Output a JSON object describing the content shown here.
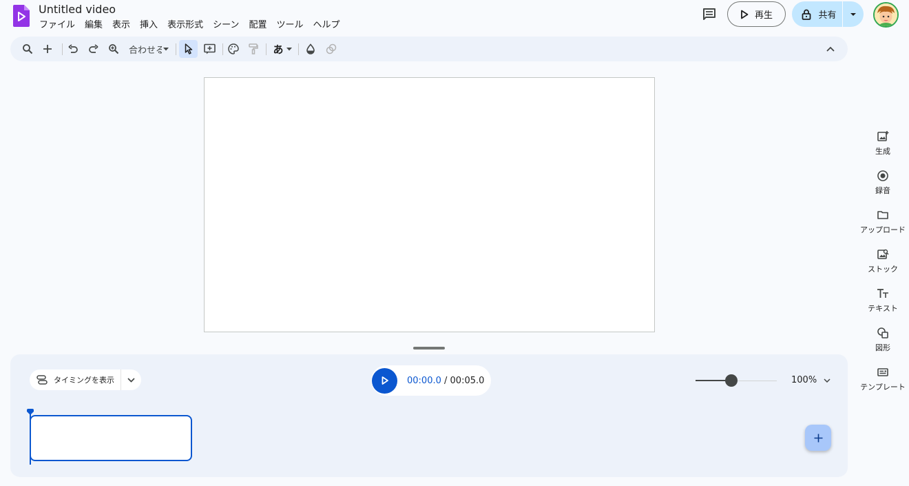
{
  "document": {
    "title": "Untitled video"
  },
  "menu": [
    "ファイル",
    "編集",
    "表示",
    "挿入",
    "表示形式",
    "シーン",
    "配置",
    "ツール",
    "ヘルプ"
  ],
  "header": {
    "play_label": "再生",
    "share_label": "共有"
  },
  "toolbar": {
    "zoom_label": "合わせる",
    "icons": [
      "search-icon",
      "add-icon",
      "undo-icon",
      "redo-icon",
      "zoom-icon",
      "select-icon",
      "text-box-icon",
      "palette-icon",
      "paint-format-icon",
      "font-icon",
      "fill-color-icon",
      "recolor-icon",
      "collapse-icon"
    ],
    "font_glyph": "あ"
  },
  "side_panel": [
    {
      "icon": "generate-image-icon",
      "label": "生成"
    },
    {
      "icon": "record-icon",
      "label": "録音"
    },
    {
      "icon": "folder-icon",
      "label": "アップロード"
    },
    {
      "icon": "stock-image-icon",
      "label": "ストック"
    },
    {
      "icon": "text-icon",
      "label": "テキスト"
    },
    {
      "icon": "shapes-icon",
      "label": "図形"
    },
    {
      "icon": "template-icon",
      "label": "テンプレート"
    }
  ],
  "timeline": {
    "timing_label": "タイミングを表示",
    "time_current": "00:00.0",
    "time_separator": " / ",
    "time_total": "00:05.0",
    "zoom_value": "100%",
    "zoom_level": 0.44
  },
  "colors": {
    "accent": "#0b57d0",
    "share_bg": "#c2e7ff",
    "toolbar_bg": "#edf2fa",
    "logo": "#9334e6"
  }
}
